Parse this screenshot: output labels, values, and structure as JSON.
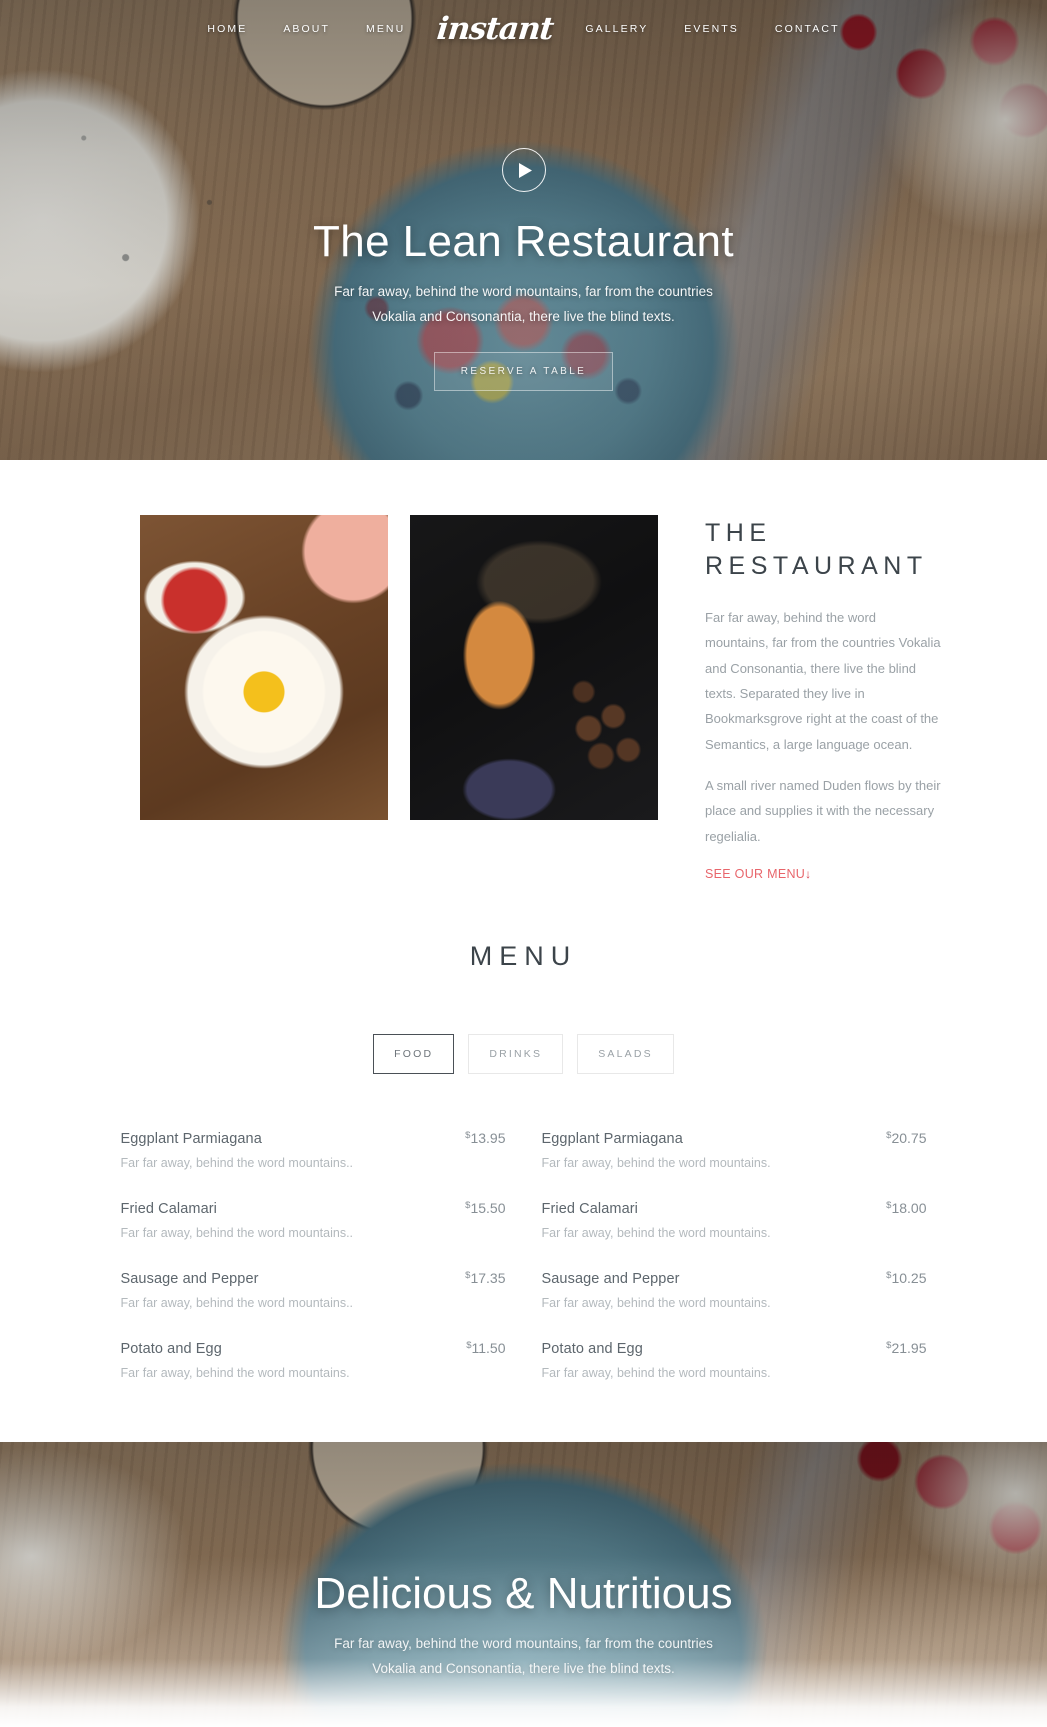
{
  "brand": {
    "name": "instant"
  },
  "nav": {
    "left": [
      {
        "label": "HOME"
      },
      {
        "label": "ABOUT"
      },
      {
        "label": "MENU"
      }
    ],
    "right": [
      {
        "label": "GALLERY"
      },
      {
        "label": "EVENTS"
      },
      {
        "label": "CONTACT"
      }
    ]
  },
  "hero": {
    "play_icon": "play-icon",
    "title": "The Lean Restaurant",
    "subtitle": "Far far away, behind the word mountains, far from the countries Vokalia and Consonantia, there live the blind texts.",
    "cta_label": "RESERVE A TABLE"
  },
  "about": {
    "image_left_alt": "fried-egg-on-toast-plate",
    "image_right_alt": "croissant-and-truffles-dark",
    "heading_line1": "THE",
    "heading_line2": "RESTAURANT",
    "paragraph1": "Far far away, behind the word mountains, far from the countries Vokalia and Consonantia, there live the blind texts. Separated they live in Bookmarksgrove right at the coast of the Semantics, a large language ocean.",
    "paragraph2": "A small river named Duden flows by their place and supplies it with the necessary regelialia.",
    "link_label": "SEE OUR MENU",
    "link_arrow": "↓"
  },
  "menu": {
    "heading": "MENU",
    "tabs": [
      {
        "label": "FOOD",
        "active": true
      },
      {
        "label": "DRINKS",
        "active": false
      },
      {
        "label": "SALADS",
        "active": false
      }
    ],
    "columns": [
      {
        "items": [
          {
            "name": "Eggplant Parmiagana",
            "currency": "$",
            "price": "13.95",
            "desc": "Far far away, behind the word mountains.."
          },
          {
            "name": "Fried Calamari",
            "currency": "$",
            "price": "15.50",
            "desc": "Far far away, behind the word mountains.."
          },
          {
            "name": "Sausage and Pepper",
            "currency": "$",
            "price": "17.35",
            "desc": "Far far away, behind the word mountains.."
          },
          {
            "name": "Potato and Egg",
            "currency": "$",
            "price": "11.50",
            "desc": "Far far away, behind the word mountains."
          }
        ]
      },
      {
        "items": [
          {
            "name": "Eggplant Parmiagana",
            "currency": "$",
            "price": "20.75",
            "desc": "Far far away, behind the word mountains."
          },
          {
            "name": "Fried Calamari",
            "currency": "$",
            "price": "18.00",
            "desc": "Far far away, behind the word mountains."
          },
          {
            "name": "Sausage and Pepper",
            "currency": "$",
            "price": "10.25",
            "desc": "Far far away, behind the word mountains."
          },
          {
            "name": "Potato and Egg",
            "currency": "$",
            "price": "21.95",
            "desc": "Far far away, behind the word mountains."
          }
        ]
      }
    ]
  },
  "cta": {
    "title": "Delicious & Nutritious",
    "subtitle": "Far far away, behind the word mountains, far from the countries Vokalia and Consonantia, there live the blind texts."
  },
  "colors": {
    "accent_link": "#e8656b",
    "heading": "#3c444a",
    "body_text": "#9aa1a6",
    "tab_active_border": "#4a5056"
  }
}
